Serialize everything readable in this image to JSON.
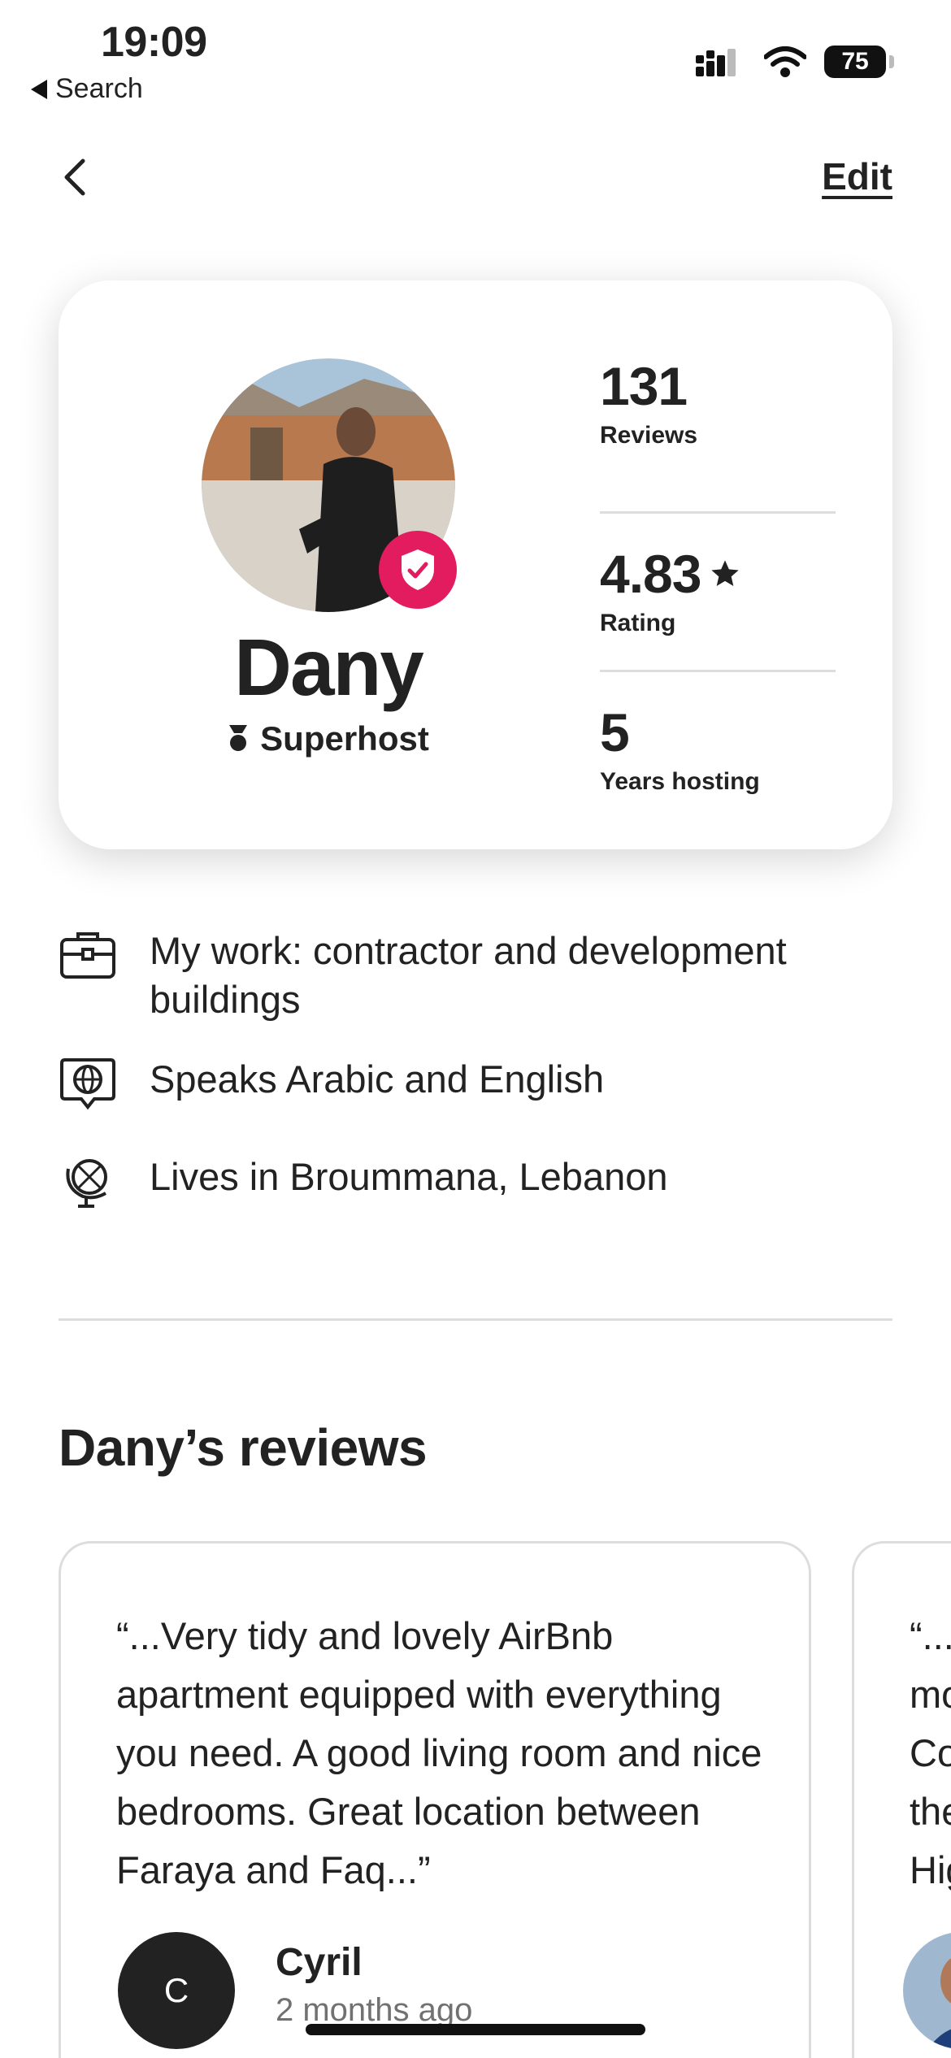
{
  "status_bar": {
    "time": "19:09",
    "back_label": "Search",
    "battery": "75"
  },
  "nav": {
    "edit_label": "Edit"
  },
  "profile": {
    "name": "Dany",
    "badge": "Superhost",
    "stats": [
      {
        "value": "131",
        "label": "Reviews"
      },
      {
        "value": "4.83",
        "label": "Rating"
      },
      {
        "value": "5",
        "label": "Years hosting"
      }
    ]
  },
  "info": {
    "work": "My work: contractor and development buildings",
    "languages": "Speaks Arabic and English",
    "location": "Lives in Broummana, Lebanon"
  },
  "reviews": {
    "title": "Dany’s reviews",
    "items": [
      {
        "text": "“...Very tidy and lovely AirBnb apartment equipped with everything you need. A good living room and nice bedrooms. Great location between Faraya and Faq...”",
        "reviewer_initial": "C",
        "reviewer_name": "Cyril",
        "date": "2 months ago"
      },
      {
        "text_lines": [
          "“...V",
          "mo",
          "Co",
          "the",
          "Hig"
        ]
      }
    ]
  },
  "colors": {
    "brand": "#e31c5f",
    "text": "#222222",
    "muted": "#717171",
    "divider": "#dddddd"
  }
}
